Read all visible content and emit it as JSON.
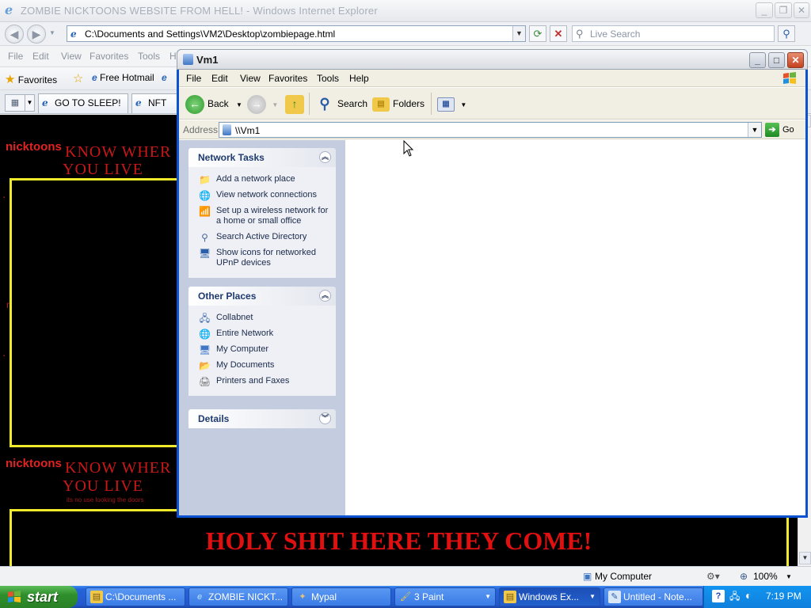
{
  "ie": {
    "title": "ZOMBIE NICKTOONS WEBSITE FROM HELL! - Windows Internet Explorer",
    "url": "C:\\Documents and Settings\\VM2\\Desktop\\zombiepage.html",
    "search_placeholder": "Live Search",
    "menu": [
      "File",
      "Edit",
      "View",
      "Favorites",
      "Tools",
      "H"
    ],
    "favorites_label": "Favorites",
    "favlinks": [
      "Free Hotmail"
    ],
    "tabs": [
      "GO TO SLEEP!",
      "NFT TEC"
    ],
    "status_zone": "My Computer",
    "zoom": "100%"
  },
  "page": {
    "nick_top": "nicktoons",
    "know_top_1": "KNOW WHER",
    "know_top_2": "YOU LIVE",
    "nick_bottom": "nicktoons",
    "know_bottom_1": "KNOW WHER",
    "know_bottom_2": "YOU LIVE",
    "tiny": "its no use looking the doors",
    "holy": "HOLY SHIT HERE THEY COME!"
  },
  "explorer": {
    "title": "Vm1",
    "menu": [
      "File",
      "Edit",
      "View",
      "Favorites",
      "Tools",
      "Help"
    ],
    "toolbar": {
      "back": "Back",
      "search": "Search",
      "folders": "Folders"
    },
    "address_label": "Address",
    "address_value": "\\\\Vm1",
    "go_label": "Go",
    "network_tasks": {
      "header": "Network Tasks",
      "items": [
        "Add a network place",
        "View network connections",
        "Set up a wireless network for a home or small office",
        "Search Active Directory",
        "Show icons for networked UPnP devices"
      ]
    },
    "other_places": {
      "header": "Other Places",
      "items": [
        "Collabnet",
        "Entire Network",
        "My Computer",
        "My Documents",
        "Printers and Faxes"
      ]
    },
    "details": {
      "header": "Details"
    }
  },
  "taskbar": {
    "start": "start",
    "buttons": [
      "C:\\Documents ...",
      "ZOMBIE NICKT...",
      "Mypal",
      "3 Paint",
      "Windows Ex...",
      "Untitled - Note..."
    ],
    "clock": "7:19 PM"
  },
  "colors": {
    "xp_blue": "#0a52d2",
    "page_black": "#000000",
    "page_red": "#e01010",
    "page_yellow": "#f1ea2a"
  }
}
